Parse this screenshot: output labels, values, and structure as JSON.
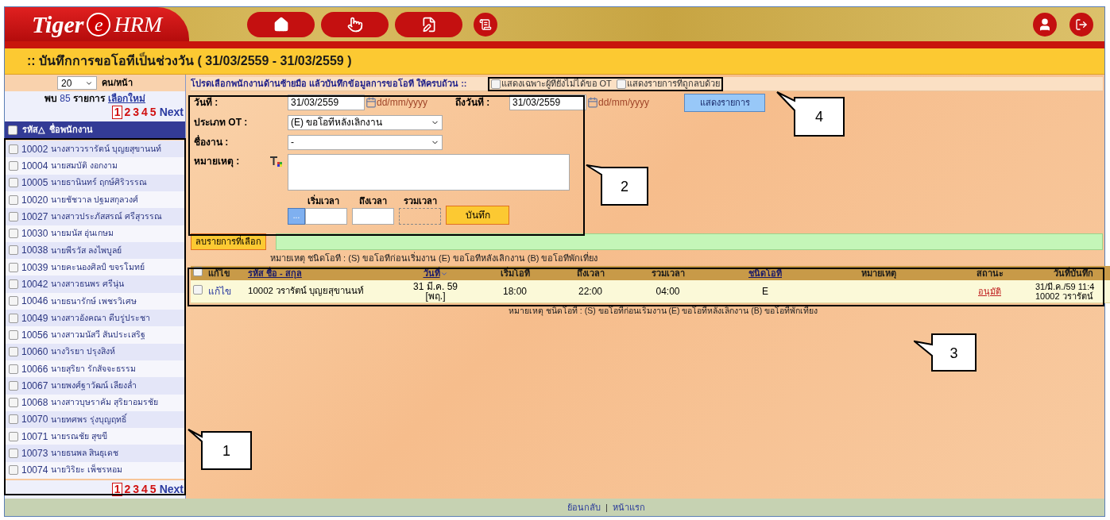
{
  "header": {
    "logo": {
      "left": "Tiger",
      "mark": "e",
      "right": "HRM"
    }
  },
  "title": ":: บันทึกการขอโอทีเป็นช่วงวัน ( 31/03/2559 - 31/03/2559 )",
  "sidebar": {
    "per_page": "20",
    "per_page_label": "คน/หน้า",
    "found_prefix": "พบ",
    "found_count": "85",
    "found_suffix": "รายการ",
    "reset_link": "เลือกใหม่",
    "pages": [
      {
        "label": "1",
        "selected": true
      },
      {
        "label": "2",
        "selected": false
      },
      {
        "label": "3",
        "selected": false
      },
      {
        "label": "4",
        "selected": false
      },
      {
        "label": "5",
        "selected": false
      }
    ],
    "next": "Next",
    "header": {
      "checked": false,
      "code": "รหัส",
      "sort_mark": "△",
      "name": "ชื่อพนักงาน"
    },
    "employees": [
      {
        "code": "10002",
        "name": "นางสาววรารัตน์ บุญยสุขานนท์",
        "checked": false
      },
      {
        "code": "10004",
        "name": "นายสมบัติ งอกงาม",
        "checked": false
      },
      {
        "code": "10005",
        "name": "นายธานินทร์ ฤกษ์ศิริวรรณ",
        "checked": false
      },
      {
        "code": "10020",
        "name": "นายชัชวาล ปฐมสกุลวงศ์",
        "checked": false
      },
      {
        "code": "10027",
        "name": "นางสาวประภัสสรณ์ ศรีสุวรรณ",
        "checked": false
      },
      {
        "code": "10030",
        "name": "นายมนัส อุ่นเกษม",
        "checked": false
      },
      {
        "code": "10038",
        "name": "นายพีรวัส ลงไพบูลย์",
        "checked": false
      },
      {
        "code": "10039",
        "name": "นายคะนองศิลป์ ขจรโมทย์",
        "checked": false
      },
      {
        "code": "10042",
        "name": "นางสาวธนพร ศรีนุ่น",
        "checked": false
      },
      {
        "code": "10046",
        "name": "นายธนารักษ์ เพชรวิเศษ",
        "checked": false
      },
      {
        "code": "10049",
        "name": "นางสาวอังคณา ดีบรู่ประชา",
        "checked": false
      },
      {
        "code": "10056",
        "name": "นางสาวมนัสวี สันประเสริฐ",
        "checked": false
      },
      {
        "code": "10060",
        "name": "นางวิรยา ปรุงสิงห์",
        "checked": false
      },
      {
        "code": "10066",
        "name": "นายสุริยา รักสัจจะธรรม",
        "checked": false
      },
      {
        "code": "10067",
        "name": "นายพงศ์ฐาวัฒน์ เลียงล่ำ",
        "checked": false
      },
      {
        "code": "10068",
        "name": "นางสาวบุษราคัม สุริยาอมรชัย",
        "checked": false
      },
      {
        "code": "10070",
        "name": "นายทศพร รุ่งบุญฤทธิ์",
        "checked": false
      },
      {
        "code": "10071",
        "name": "นายรณชัย สุขขี",
        "checked": false
      },
      {
        "code": "10073",
        "name": "นายธนพล สินธุเดช",
        "checked": false
      },
      {
        "code": "10074",
        "name": "นายวิริยะ เพ็ชรหอม",
        "checked": false
      }
    ],
    "bottom_pages": [
      {
        "label": "1",
        "selected": true
      },
      {
        "label": "2",
        "selected": false
      },
      {
        "label": "3",
        "selected": false
      },
      {
        "label": "4",
        "selected": false
      },
      {
        "label": "5",
        "selected": false
      }
    ],
    "bottom_next": "Next"
  },
  "instruction": "โปรดเลือกพนักงานด้านซ้ายมือ แล้วบันทึกข้อมูลการขอโอที ให้ครบถ้วน ::",
  "options": [
    {
      "label": "แสดงเฉพาะผู้ที่ยังไม่ได้ขอ OT",
      "checked": false
    },
    {
      "label": "แสดงรายการที่ถูกลบด้วย",
      "checked": false
    }
  ],
  "form": {
    "date_label": "วันที่ :",
    "date_value": "31/03/2559",
    "date_hint": "dd/mm/yyyy",
    "to_date_label": "ถึงวันที่ :",
    "to_date_value": "31/03/2559",
    "to_date_hint": "dd/mm/yyyy",
    "show_button": "แสดงรายการ",
    "ot_type_label": "ประเภท OT :",
    "ot_type_value": "(E) ขอโอทีหลังเลิกงาน",
    "job_label": "ชื่องาน :",
    "job_value": "-",
    "note_label": "หมายเหตุ :",
    "start_label": "เริ่มเวลา",
    "end_label": "ถึงเวลา",
    "total_label": "รวมเวลา",
    "picker_button": "...",
    "save_button": "บันทึก"
  },
  "delete_button": "ลบรายการที่เลือก",
  "legend_top": "หมายเหตุ ชนิดโอที : (S) ขอโอทีก่อนเริ่มงาน (E) ขอโอทีหลังเลิกงาน (B) ขอโอทีพักเที่ยง",
  "table": {
    "header_checked": false,
    "columns": [
      "แก้ไข",
      "รหัส ชื่อ - สกุล",
      "วันที่",
      "เริ่มโอที",
      "ถึงเวลา",
      "รวมเวลา",
      "ชนิดโอที",
      "หมายเหตุ",
      "สถานะ",
      "วันที่บันทึก"
    ],
    "rows": [
      {
        "checked": false,
        "edit": "แก้ไข",
        "employee": "10002 วรารัตน์ บุญยสุขานนท์",
        "date": "31 มี.ค. 59",
        "day": "[พฤ.]",
        "start": "18:00",
        "end": "22:00",
        "total": "04:00",
        "ot_type": "E",
        "status": "อนุมัติ",
        "saved": "31/มี.ค./59 11:4",
        "saved_by": "10002 วรารัตน์"
      }
    ]
  },
  "legend_bottom": "หมายเหตุ ชนิดโอที : (S) ขอโอทีก่อนเริ่มงาน (E) ขอโอทีหลังเลิกงาน (B) ขอโอทีพักเที่ยง",
  "footer": {
    "links": [
      "ย้อนกลับ",
      "หน้าแรก"
    ],
    "separator": "|"
  },
  "callouts": [
    {
      "number": "1"
    },
    {
      "number": "2"
    },
    {
      "number": "3"
    },
    {
      "number": "4"
    }
  ]
}
